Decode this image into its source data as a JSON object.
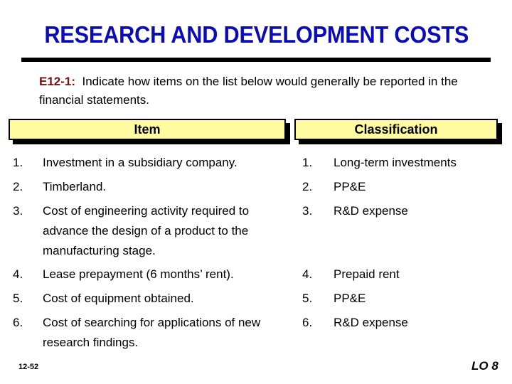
{
  "slide": {
    "title": "RESEARCH AND DEVELOPMENT COSTS",
    "exercise_ref": "E12-1:",
    "instructions": "Indicate how items on the list below would generally be reported in the financial statements.",
    "colors": {
      "title": "#0b0bb8",
      "exercise_ref": "#7a1010",
      "header_fill": "#fefba0"
    }
  },
  "table": {
    "headers": {
      "item": "Item",
      "classification": "Classification"
    },
    "rows": [
      {
        "num": "1.",
        "item": "Investment in a subsidiary company.",
        "class_num": "1.",
        "classification": "Long-term investments"
      },
      {
        "num": "2.",
        "item": "Timberland.",
        "class_num": "2.",
        "classification": "PP&E"
      },
      {
        "num": "3.",
        "item": "Cost of engineering activity required to advance the design of a product to the manufacturing stage.",
        "class_num": "3.",
        "classification": "R&D expense"
      },
      {
        "num": "4.",
        "item": "Lease prepayment (6 months’ rent).",
        "class_num": "4.",
        "classification": "Prepaid rent"
      },
      {
        "num": "5.",
        "item": "Cost of equipment obtained.",
        "class_num": "5.",
        "classification": "PP&E"
      },
      {
        "num": "6.",
        "item": "Cost of searching for applications of new research findings.",
        "class_num": "6.",
        "classification": "R&D expense"
      }
    ]
  },
  "footer": {
    "slide_number": "12-52",
    "learning_objective": "LO 8"
  }
}
